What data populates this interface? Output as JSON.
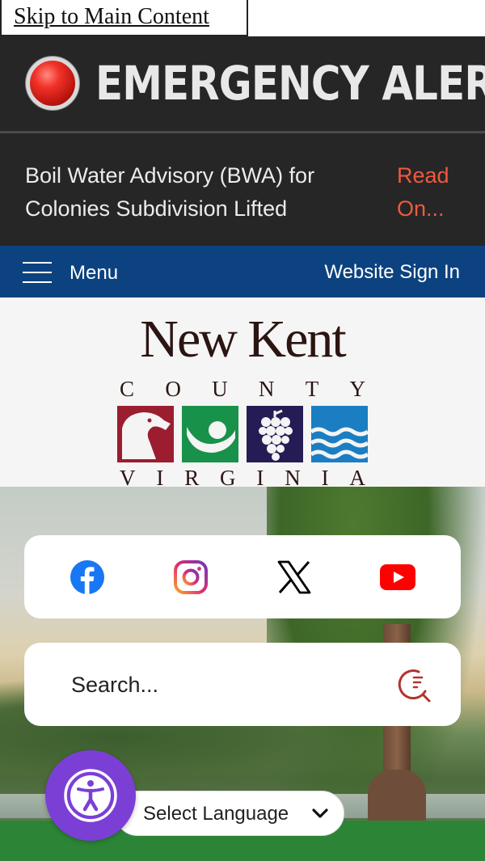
{
  "skip_link": {
    "label": "Skip to Main Content"
  },
  "alert": {
    "title": "EMERGENCY ALERT",
    "icon": "red-alert-light-icon",
    "color": "#f13228"
  },
  "advisory": {
    "text": "Boil Water Advisory (BWA) for Colonies Subdivision Lifted",
    "link_label": "Read On...",
    "link_color": "#f05a3e"
  },
  "nav": {
    "menu_label": "Menu",
    "menu_icon": "hamburger-icon",
    "sign_in_label": "Website Sign In",
    "bar_color": "#0d4280"
  },
  "logo": {
    "title": "New Kent",
    "county_letters": [
      "C",
      "O",
      "U",
      "N",
      "T",
      "Y"
    ],
    "state_letters": [
      "V",
      "I",
      "R",
      "G",
      "I",
      "N",
      "I",
      "A"
    ],
    "tiles": [
      {
        "icon": "horse-head-icon",
        "color": "#9b1d2f"
      },
      {
        "icon": "golf-ball-icon",
        "color": "#18914a"
      },
      {
        "icon": "grapes-icon",
        "color": "#261c55"
      },
      {
        "icon": "water-waves-icon",
        "color": "#1b7ec2"
      }
    ]
  },
  "social": [
    {
      "name": "facebook",
      "icon": "facebook-icon",
      "color": "#1877f2"
    },
    {
      "name": "instagram",
      "icon": "instagram-icon",
      "color": "#d62976"
    },
    {
      "name": "x",
      "icon": "x-icon",
      "color": "#000000"
    },
    {
      "name": "youtube",
      "icon": "youtube-icon",
      "color": "#ff0000"
    }
  ],
  "search": {
    "placeholder": "Search...",
    "icon": "search-icon",
    "icon_color": "#b3342d"
  },
  "language": {
    "label": "Select Language",
    "icon": "chevron-down-icon"
  },
  "accessibility": {
    "icon": "accessibility-icon",
    "color": "#7b3fd6"
  }
}
